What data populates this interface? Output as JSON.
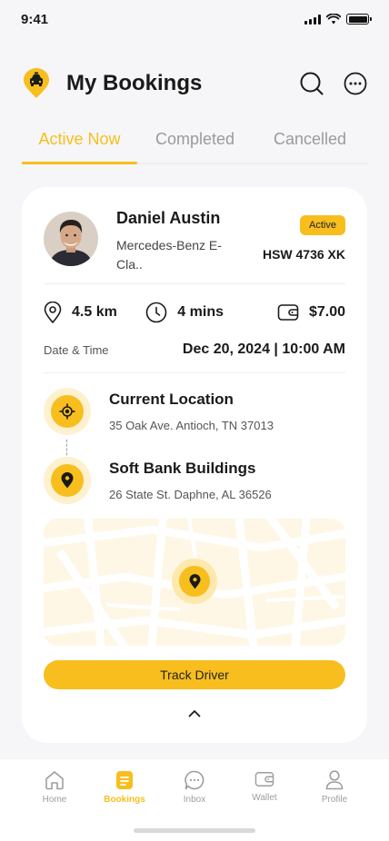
{
  "status_bar": {
    "time": "9:41"
  },
  "header": {
    "title": "My Bookings",
    "logo_icon": "taxi-pin-icon",
    "search_icon": "search-icon",
    "more_icon": "more-options-icon"
  },
  "tabs": [
    {
      "label": "Active Now",
      "active": true
    },
    {
      "label": "Completed",
      "active": false
    },
    {
      "label": "Cancelled",
      "active": false
    }
  ],
  "booking": {
    "driver_name": "Daniel Austin",
    "car_model": "Mercedes-Benz E-Cla..",
    "status": "Active",
    "plate": "HSW 4736 XK",
    "distance": "4.5 km",
    "duration": "4 mins",
    "price": "$7.00",
    "datetime_label": "Date & Time",
    "datetime_value": "Dec 20, 2024 | 10:00 AM",
    "pickup": {
      "title": "Current Location",
      "address": "35 Oak Ave. Antioch, TN 37013"
    },
    "dropoff": {
      "title": "Soft Bank Buildings",
      "address": "26 State St. Daphne, AL 36526"
    },
    "track_label": "Track Driver"
  },
  "bottom_nav": [
    {
      "label": "Home",
      "icon": "home-icon",
      "active": false
    },
    {
      "label": "Bookings",
      "icon": "bookings-icon",
      "active": true
    },
    {
      "label": "Inbox",
      "icon": "chat-icon",
      "active": false
    },
    {
      "label": "Wallet",
      "icon": "wallet-icon",
      "active": false
    },
    {
      "label": "Profile",
      "icon": "profile-icon",
      "active": false
    }
  ],
  "colors": {
    "accent": "#F7BE1E",
    "accent_light": "#FDF1CF",
    "background": "#F6F6F8",
    "text": "#1A1A1A",
    "muted": "#9E9E9E"
  }
}
